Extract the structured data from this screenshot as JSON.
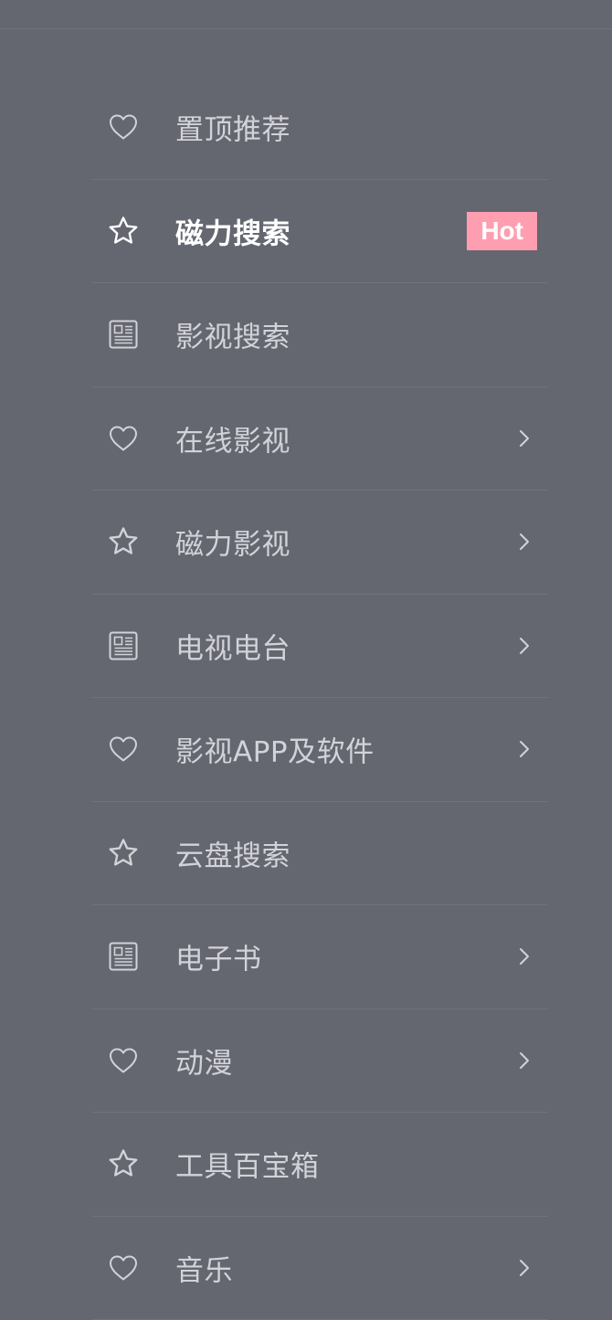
{
  "colors": {
    "background": "#646670",
    "divider": "#70727c",
    "text": "#d2d3d8",
    "active_text": "#ffffff",
    "badge_background": "#ff9eb1"
  },
  "menu": {
    "items": [
      {
        "label": "置顶推荐",
        "icon": "heart-icon",
        "active": false,
        "has_submenu": false
      },
      {
        "label": "磁力搜索",
        "icon": "star-icon",
        "active": true,
        "has_submenu": false,
        "badge": "Hot"
      },
      {
        "label": "影视搜索",
        "icon": "newspaper-icon",
        "active": false,
        "has_submenu": false
      },
      {
        "label": "在线影视",
        "icon": "heart-icon",
        "active": false,
        "has_submenu": true
      },
      {
        "label": "磁力影视",
        "icon": "star-icon",
        "active": false,
        "has_submenu": true
      },
      {
        "label": "电视电台",
        "icon": "newspaper-icon",
        "active": false,
        "has_submenu": true
      },
      {
        "label": "影视APP及软件",
        "icon": "heart-icon",
        "active": false,
        "has_submenu": true
      },
      {
        "label": "云盘搜索",
        "icon": "star-icon",
        "active": false,
        "has_submenu": false
      },
      {
        "label": "电子书",
        "icon": "newspaper-icon",
        "active": false,
        "has_submenu": true
      },
      {
        "label": "动漫",
        "icon": "heart-icon",
        "active": false,
        "has_submenu": true
      },
      {
        "label": "工具百宝箱",
        "icon": "star-icon",
        "active": false,
        "has_submenu": false
      },
      {
        "label": "音乐",
        "icon": "heart-icon",
        "active": false,
        "has_submenu": true
      }
    ]
  }
}
